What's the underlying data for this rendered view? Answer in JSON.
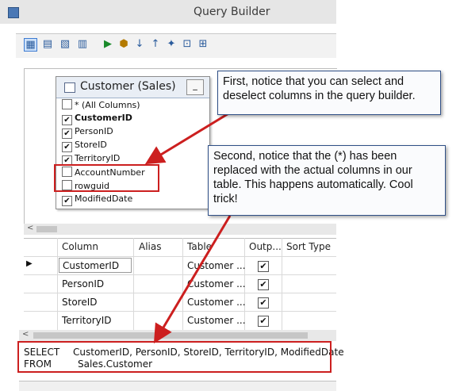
{
  "window": {
    "title": "Query Builder"
  },
  "table_box": {
    "title": "Customer (Sales)",
    "min_label": "_",
    "columns": [
      {
        "label": "* (All Columns)",
        "checked": false,
        "bold": false
      },
      {
        "label": "CustomerID",
        "checked": true,
        "bold": true
      },
      {
        "label": "PersonID",
        "checked": true,
        "bold": false
      },
      {
        "label": "StoreID",
        "checked": true,
        "bold": false
      },
      {
        "label": "TerritoryID",
        "checked": true,
        "bold": false
      },
      {
        "label": "AccountNumber",
        "checked": false,
        "bold": false
      },
      {
        "label": "rowguid",
        "checked": false,
        "bold": false
      },
      {
        "label": "ModifiedDate",
        "checked": true,
        "bold": false
      }
    ]
  },
  "grid": {
    "headers": [
      "Column",
      "Alias",
      "Table",
      "Outp...",
      "Sort Type"
    ],
    "rows": [
      {
        "column": "CustomerID",
        "alias": "",
        "table": "Customer ...",
        "output": true
      },
      {
        "column": "PersonID",
        "alias": "",
        "table": "Customer ...",
        "output": true
      },
      {
        "column": "StoreID",
        "alias": "",
        "table": "Customer ...",
        "output": true
      },
      {
        "column": "TerritoryID",
        "alias": "",
        "table": "Customer ...",
        "output": true
      }
    ]
  },
  "sql": {
    "line1_keyword": "SELECT",
    "line1_text": "CustomerID, PersonID, StoreID, TerritoryID, ModifiedDate",
    "line2_keyword": "FROM",
    "line2_text": "Sales.Customer"
  },
  "callouts": {
    "first": "First, notice that you can select and deselect columns in the query builder.",
    "second": "Second, notice that the (*) has been replaced with the actual columns in our table. This happens automatically. Cool trick!"
  },
  "colors": {
    "accent_red": "#cc1f1f",
    "callout_border": "#2f4f86"
  }
}
